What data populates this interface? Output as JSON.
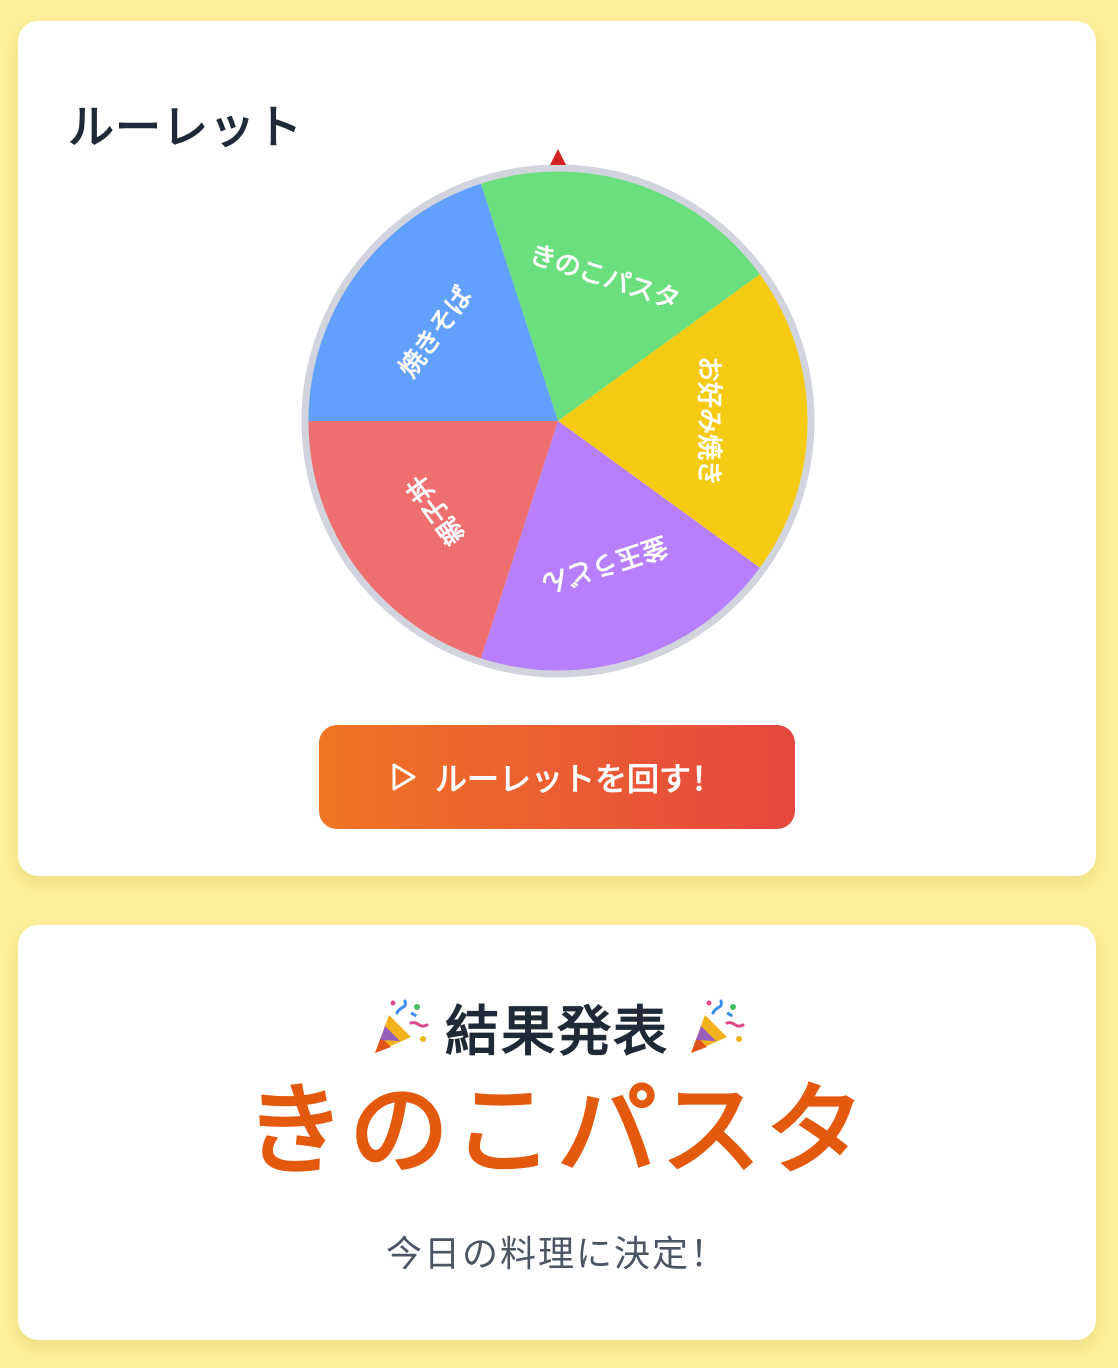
{
  "roulette": {
    "title": "ルーレット",
    "segments": [
      {
        "label": "きのこパスタ",
        "color": "#6bde7e"
      },
      {
        "label": "お好み焼き",
        "color": "#f5ca13"
      },
      {
        "label": "釜玉うどん",
        "color": "#b77ffd"
      },
      {
        "label": "親子丼",
        "color": "#ee6f6f"
      },
      {
        "label": "焼きそば",
        "color": "#62a0fd"
      }
    ],
    "rim_color": "#d1d4dc",
    "pointer_color": "#d32020",
    "spin_button_label": "ルーレットを回す！",
    "spin_button_icon": "play-icon"
  },
  "result": {
    "heading": "結果発表",
    "heading_icon": "party-popper-icon",
    "value": "きのこパスタ",
    "subtext": "今日の料理に決定！"
  },
  "colors": {
    "background": "#fdf09a",
    "accent": "#e35a0e",
    "button_gradient_start": "#f07423",
    "button_gradient_end": "#e5483f"
  }
}
